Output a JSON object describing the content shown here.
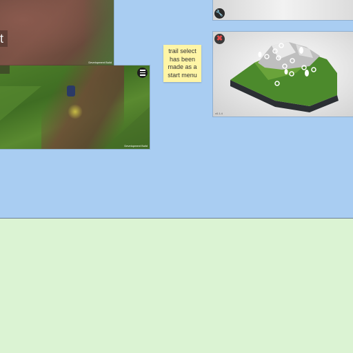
{
  "board": {
    "background_color": "#a9cdf2",
    "lower_area_color": "#dbf3d3"
  },
  "screenshots": {
    "top_left": {
      "partial_text": "t",
      "watermark": "Development Build"
    },
    "gameplay": {
      "watermark": "Development Build",
      "menu_icon": "hamburger-menu-icon"
    },
    "top_right": {
      "tool_icon": "wrench-icon"
    },
    "island_map": {
      "close_icon": "close-icon",
      "trail_markers": 10,
      "footer": "v0.1.4"
    }
  },
  "sticky_note": {
    "text": "trail select has been made as a start menu",
    "color": "#fff5a6"
  }
}
